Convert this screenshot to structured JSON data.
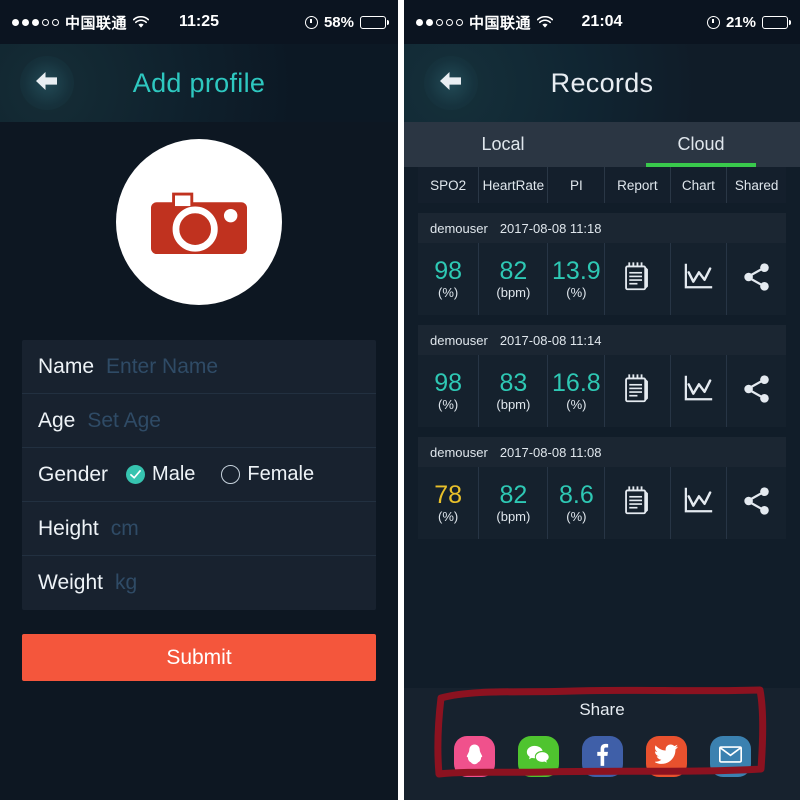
{
  "left_screen": {
    "status_bar": {
      "signal_dots_filled": 3,
      "signal_dots_total": 5,
      "carrier": "中国联通",
      "wifi_icon": "wifi-icon",
      "time": "11:25",
      "alarm_icon": "alarm-clock-icon",
      "battery_percent": "58%",
      "battery_level": 58
    },
    "nav": {
      "back_icon": "arrow-left-icon",
      "title": "Add profile"
    },
    "avatar": {
      "icon": "camera-icon",
      "bg_color": "#ffffff",
      "icon_color": "#c0321f"
    },
    "form": {
      "fields": [
        {
          "label": "Name",
          "placeholder": "Enter Name",
          "value": ""
        },
        {
          "label": "Age",
          "placeholder": "Set Age",
          "value": ""
        },
        {
          "label": "Height",
          "placeholder": "cm",
          "value": ""
        },
        {
          "label": "Weight",
          "placeholder": "kg",
          "value": ""
        }
      ],
      "gender": {
        "label": "Gender",
        "options": [
          {
            "label": "Male",
            "selected": true
          },
          {
            "label": "Female",
            "selected": false
          }
        ],
        "selected_color": "#36c4b0"
      }
    },
    "submit_button": {
      "label": "Submit",
      "color": "#f4563c"
    }
  },
  "right_screen": {
    "status_bar": {
      "signal_dots_filled": 2,
      "signal_dots_total": 5,
      "carrier": "中国联通",
      "wifi_icon": "wifi-icon",
      "time": "21:04",
      "alarm_icon": "alarm-clock-icon",
      "battery_percent": "21%",
      "battery_level": 21
    },
    "nav": {
      "back_icon": "arrow-left-icon",
      "title": "Records"
    },
    "tabs": [
      {
        "label": "Local",
        "active": false
      },
      {
        "label": "Cloud",
        "active": true
      }
    ],
    "tab_indicator_color": "#39c94c",
    "columns": [
      "SPO2",
      "HeartRate",
      "PI",
      "Report",
      "Chart",
      "Shared"
    ],
    "records": [
      {
        "user": "demouser",
        "timestamp": "2017-08-08 11:18",
        "spo2": "98",
        "spo2_unit": "(%)",
        "spo2_status": "ok",
        "heart_rate": "82",
        "heart_rate_unit": "(bpm)",
        "pi": "13.9",
        "pi_unit": "(%)",
        "report_icon": "notepad-icon",
        "chart_icon": "line-chart-icon",
        "share_icon": "share-nodes-icon"
      },
      {
        "user": "demouser",
        "timestamp": "2017-08-08 11:14",
        "spo2": "98",
        "spo2_unit": "(%)",
        "spo2_status": "ok",
        "heart_rate": "83",
        "heart_rate_unit": "(bpm)",
        "pi": "16.8",
        "pi_unit": "(%)",
        "report_icon": "notepad-icon",
        "chart_icon": "line-chart-icon",
        "share_icon": "share-nodes-icon"
      },
      {
        "user": "demouser",
        "timestamp": "2017-08-08 11:08",
        "spo2": "78",
        "spo2_unit": "(%)",
        "spo2_status": "warn",
        "heart_rate": "82",
        "heart_rate_unit": "(bpm)",
        "pi": "8.6",
        "pi_unit": "(%)",
        "report_icon": "notepad-icon",
        "chart_icon": "line-chart-icon",
        "share_icon": "share-nodes-icon"
      }
    ],
    "value_colors": {
      "ok": "#2ec8b4",
      "warn": "#e8c02a"
    },
    "share_panel": {
      "title": "Share",
      "items": [
        {
          "name": "qq",
          "icon": "qq-penguin-icon",
          "color": "#f0518c"
        },
        {
          "name": "wechat",
          "icon": "wechat-icon",
          "color": "#4fc42f"
        },
        {
          "name": "facebook",
          "icon": "facebook-f-icon",
          "color": "#3f5fa8"
        },
        {
          "name": "twitter",
          "icon": "twitter-bird-icon",
          "color": "#e8512e"
        },
        {
          "name": "email",
          "icon": "envelope-icon",
          "color": "#3b81b0"
        }
      ]
    },
    "annotation": {
      "shape": "hand-drawn-rectangle",
      "color": "#8c1220"
    }
  }
}
